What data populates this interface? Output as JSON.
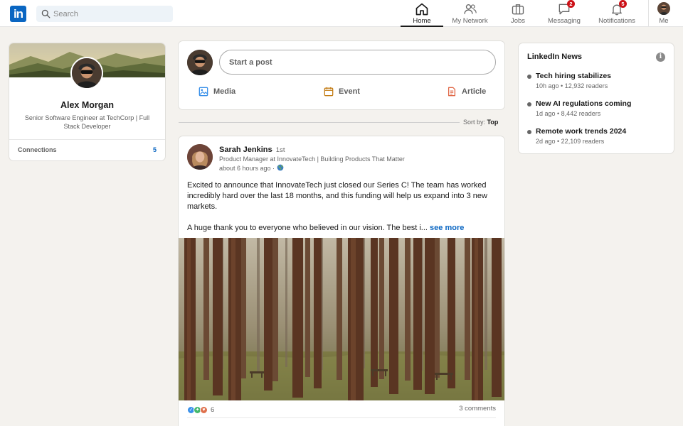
{
  "brand": {
    "logo_text": "in",
    "color": "#0a66c2"
  },
  "search": {
    "placeholder": "Search",
    "value": ""
  },
  "nav": [
    {
      "label": "Home",
      "icon": "home-icon",
      "active": true
    },
    {
      "label": "My Network",
      "icon": "network-icon"
    },
    {
      "label": "Jobs",
      "icon": "briefcase-icon"
    },
    {
      "label": "Messaging",
      "icon": "message-icon",
      "badge": "2"
    },
    {
      "label": "Notifications",
      "icon": "bell-icon",
      "badge": "5"
    },
    {
      "label": "Me",
      "icon": "avatar"
    }
  ],
  "profile": {
    "name": "Alex Morgan",
    "headline": "Senior Software Engineer at TechCorp | Full Stack Developer",
    "connections_label": "Connections",
    "connections_count": "5"
  },
  "composer": {
    "placeholder": "Start a post",
    "actions": [
      {
        "label": "Media",
        "icon": "image-icon",
        "color": "#378fe9"
      },
      {
        "label": "Event",
        "icon": "calendar-icon",
        "color": "#c37d16"
      },
      {
        "label": "Article",
        "icon": "article-icon",
        "color": "#e06847"
      }
    ]
  },
  "feed": {
    "sort_prefix": "Sort by:",
    "sort_value": "Top"
  },
  "post": {
    "author": "Sarah Jenkins",
    "degree": "· 1st",
    "headline": "Product Manager at InnovateTech | Building Products That Matter",
    "time": "about 6 hours ago ·",
    "visibility_icon": "globe-icon",
    "body_p1": "Excited to announce that InnovateTech just closed our Series C! The team has worked incredibly hard over the last 18 months, and this funding will help us expand into 3 new markets.",
    "body_p2": "A huge thank you to everyone who believed in our vision. The best i...",
    "see_more": "see more",
    "image_icon": "forest-photo",
    "reaction_icons": [
      "like-icon",
      "celebrate-icon",
      "love-icon"
    ],
    "reaction_count": "6",
    "comments": "3 comments"
  },
  "news": {
    "title": "LinkedIn News",
    "info_icon": "info-icon",
    "items": [
      {
        "headline": "Tech hiring stabilizes",
        "meta": "10h ago • 12,932 readers"
      },
      {
        "headline": "New AI regulations coming",
        "meta": "1d ago • 8,442 readers"
      },
      {
        "headline": "Remote work trends 2024",
        "meta": "2d ago • 22,109 readers"
      }
    ]
  }
}
